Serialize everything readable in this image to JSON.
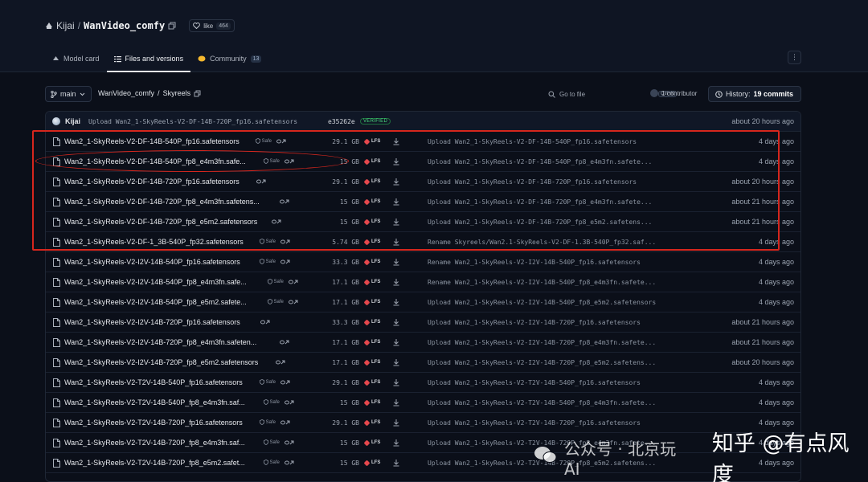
{
  "repo": {
    "owner": "Kijai",
    "name": "WanVideo_comfy",
    "like_label": "like",
    "like_count": "464"
  },
  "tabs": [
    {
      "label": "Model card"
    },
    {
      "label": "Files and versions"
    },
    {
      "label": "Community",
      "badge": "13"
    }
  ],
  "bar": {
    "branch": "main",
    "path_repo": "WanVideo_comfy",
    "path_sep": "/",
    "path_folder": "Skyreels",
    "goto_placeholder": "Go to file",
    "goto_kbd": "Ctrl+K",
    "contributors": "1 contributor",
    "history_label": "History:",
    "history_count": "19 commits"
  },
  "commit": {
    "user": "Kijai",
    "message": "Upload Wan2_1-SkyReels-V2-DF-14B-720P_fp16.safetensors",
    "hash": "e35262e",
    "verified": "VERIFIED",
    "time": "about 20 hours ago"
  },
  "files": [
    {
      "name": "Wan2_1-SkyReels-V2-DF-14B-540P_fp16.safetensors",
      "safe": "Safe",
      "size": "29.1 GB",
      "lfs": "LFS",
      "message": "Upload Wan2_1-SkyReels-V2-DF-14B-540P_fp16.safetensors",
      "time": "4 days ago"
    },
    {
      "name": "Wan2_1-SkyReels-V2-DF-14B-540P_fp8_e4m3fn.safe...",
      "safe": "Safe",
      "size": "15 GB",
      "lfs": "LFS",
      "message": "Upload Wan2_1-SkyReels-V2-DF-14B-540P_fp8_e4m3fn.safete...",
      "time": "4 days ago"
    },
    {
      "name": "Wan2_1-SkyReels-V2-DF-14B-720P_fp16.safetensors",
      "safe": "",
      "size": "29.1 GB",
      "lfs": "LFS",
      "message": "Upload Wan2_1-SkyReels-V2-DF-14B-720P_fp16.safetensors",
      "time": "about 20 hours ago"
    },
    {
      "name": "Wan2_1-SkyReels-V2-DF-14B-720P_fp8_e4m3fn.safetens...",
      "safe": "",
      "size": "15 GB",
      "lfs": "LFS",
      "message": "Upload Wan2_1-SkyReels-V2-DF-14B-720P_fp8_e4m3fn.safete...",
      "time": "about 21 hours ago"
    },
    {
      "name": "Wan2_1-SkyReels-V2-DF-14B-720P_fp8_e5m2.safetensors",
      "safe": "",
      "size": "15 GB",
      "lfs": "LFS",
      "message": "Upload Wan2_1-SkyReels-V2-DF-14B-720P_fp8_e5m2.safetens...",
      "time": "about 21 hours ago"
    },
    {
      "name": "Wan2_1-SkyReels-V2-DF-1_3B-540P_fp32.safetensors",
      "safe": "Safe",
      "size": "5.74 GB",
      "lfs": "LFS",
      "message": "Rename Skyreels/Wan2.1-SkyReels-V2-DF-1.3B-540P_fp32.saf...",
      "time": "4 days ago"
    },
    {
      "name": "Wan2_1-SkyReels-V2-I2V-14B-540P_fp16.safetensors",
      "safe": "Safe",
      "size": "33.3 GB",
      "lfs": "LFS",
      "message": "Rename Wan2_1-SkyReels-V2-I2V-14B-540P_fp16.safetensors",
      "time": "4 days ago"
    },
    {
      "name": "Wan2_1-SkyReels-V2-I2V-14B-540P_fp8_e4m3fn.safe...",
      "safe": "Safe",
      "size": "17.1 GB",
      "lfs": "LFS",
      "message": "Rename Wan2_1-SkyReels-V2-I2V-14B-540P_fp8_e4m3fn.safete...",
      "time": "4 days ago"
    },
    {
      "name": "Wan2_1-SkyReels-V2-I2V-14B-540P_fp8_e5m2.safete...",
      "safe": "Safe",
      "size": "17.1 GB",
      "lfs": "LFS",
      "message": "Upload Wan2_1-SkyReels-V2-I2V-14B-540P_fp8_e5m2.safetensors",
      "time": "4 days ago"
    },
    {
      "name": "Wan2_1-SkyReels-V2-I2V-14B-720P_fp16.safetensors",
      "safe": "",
      "size": "33.3 GB",
      "lfs": "LFS",
      "message": "Upload Wan2_1-SkyReels-V2-I2V-14B-720P_fp16.safetensors",
      "time": "about 21 hours ago"
    },
    {
      "name": "Wan2_1-SkyReels-V2-I2V-14B-720P_fp8_e4m3fn.safeten...",
      "safe": "",
      "size": "17.1 GB",
      "lfs": "LFS",
      "message": "Upload Wan2_1-SkyReels-V2-I2V-14B-720P_fp8_e4m3fn.safete...",
      "time": "about 21 hours ago"
    },
    {
      "name": "Wan2_1-SkyReels-V2-I2V-14B-720P_fp8_e5m2.safetensors",
      "safe": "",
      "size": "17.1 GB",
      "lfs": "LFS",
      "message": "Upload Wan2_1-SkyReels-V2-I2V-14B-720P_fp8_e5m2.safetens...",
      "time": "about 20 hours ago"
    },
    {
      "name": "Wan2_1-SkyReels-V2-T2V-14B-540P_fp16.safetensors",
      "safe": "Safe",
      "size": "29.1 GB",
      "lfs": "LFS",
      "message": "Upload Wan2_1-SkyReels-V2-T2V-14B-540P_fp16.safetensors",
      "time": "4 days ago"
    },
    {
      "name": "Wan2_1-SkyReels-V2-T2V-14B-540P_fp8_e4m3fn.saf...",
      "safe": "Safe",
      "size": "15 GB",
      "lfs": "LFS",
      "message": "Upload Wan2_1-SkyReels-V2-T2V-14B-540P_fp8_e4m3fn.safete...",
      "time": "4 days ago"
    },
    {
      "name": "Wan2_1-SkyReels-V2-T2V-14B-720P_fp16.safetensors",
      "safe": "Safe",
      "size": "29.1 GB",
      "lfs": "LFS",
      "message": "Upload Wan2_1-SkyReels-V2-T2V-14B-720P_fp16.safetensors",
      "time": "4 days ago"
    },
    {
      "name": "Wan2_1-SkyReels-V2-T2V-14B-720P_fp8_e4m3fn.saf...",
      "safe": "Safe",
      "size": "15 GB",
      "lfs": "LFS",
      "message": "Upload Wan2_1-SkyReels-V2-T2V-14B-720P_fp8_e4m3fn.safete...",
      "time": "4 days ago"
    },
    {
      "name": "Wan2_1-SkyReels-V2-T2V-14B-720P_fp8_e5m2.safet...",
      "safe": "Safe",
      "size": "15 GB",
      "lfs": "LFS",
      "message": "Upload Wan2_1-SkyReels-V2-T2V-14B-720P_fp8_e5m2.safetens...",
      "time": "4 days ago"
    }
  ],
  "watermark": {
    "left": "公众号 · 北京玩AI",
    "right": "知乎 @有点风度"
  },
  "colors": {
    "background": "#0b0f19",
    "annotation": "#d6261d",
    "lfs": "#e5484d",
    "verified": "#4ade80"
  }
}
